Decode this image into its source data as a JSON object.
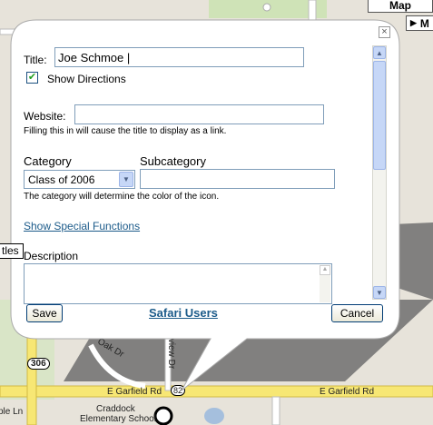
{
  "map": {
    "map_button": "Map",
    "more_button": "M",
    "labels": {
      "road_left": "ple Ln",
      "garfield_center": "E Garfield Rd",
      "garfield_right": "E Garfield Rd",
      "school_line1": "Craddock",
      "school_line2": "Elementary School",
      "oak": "Oak Dr",
      "view": "view Dr",
      "route": "306",
      "route_small": "82",
      "titles_tab": "tles"
    }
  },
  "form": {
    "title_label": "Title:",
    "title_value": "Joe Schmoe |",
    "show_directions_label": "Show Directions",
    "show_directions_checked": true,
    "website_label": "Website:",
    "website_value": "",
    "website_hint": "Filling this in will cause the title to display as a link.",
    "category_label": "Category",
    "category_value": "Class of 2006",
    "subcategory_label": "Subcategory",
    "subcategory_value": "",
    "category_hint": "The category will determine the color of the icon.",
    "special_functions_link": "Show Special Functions",
    "description_label": "Description",
    "description_value": ""
  },
  "buttons": {
    "save": "Save",
    "safari_users": "Safari Users",
    "cancel": "Cancel"
  },
  "icons": {
    "close": "close-icon",
    "dropdown": "chevron-down-icon",
    "checkbox": "checkmark-icon",
    "play": "play-icon"
  },
  "colors": {
    "link": "#1c5b8a",
    "accent": "#c6d7f7",
    "road_yellow": "#f7e774",
    "popup_bg": "#ffffff"
  }
}
